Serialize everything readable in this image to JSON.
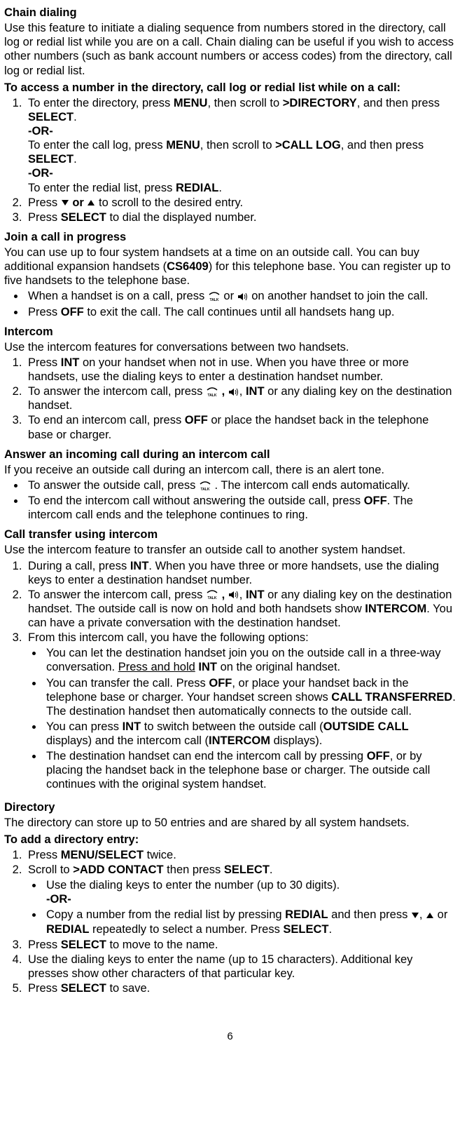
{
  "page_number": "6",
  "sections": {
    "chain_dialing": {
      "title": "Chain dialing",
      "intro": "Use this feature to initiate a dialing sequence from numbers stored in the directory, call log or redial list while you are on a call. Chain dialing can be useful if you wish to access other numbers (such as bank account numbers or access codes) from the directory, call log or redial list.",
      "access_heading": "To access a number in the directory, call log or redial list while on a call:",
      "step1_a": "To enter the directory, press ",
      "step1_b": "MENU",
      "step1_c": ", then scroll to ",
      "step1_d": ">DIRECTORY",
      "step1_e": ", and then press ",
      "step1_f": "SELECT",
      "step1_g": ".",
      "or": "-OR-",
      "step1h_a": "To enter the call log, press ",
      "step1h_b": "MENU",
      "step1h_c": ", then scroll to ",
      "step1h_d": ">CALL LOG",
      "step1h_e": ", and then press ",
      "step1h_f": "SELECT",
      "step1h_g": ".",
      "step1i_a": "To enter the redial list, press ",
      "step1i_b": "REDIAL",
      "step1i_c": ".",
      "step2_a": "Press ",
      "step2_b": " or ",
      "step2_c": " to scroll to the desired entry.",
      "step3_a": "Press ",
      "step3_b": "SELECT",
      "step3_c": " to dial the displayed number."
    },
    "join_call": {
      "title": "Join a call in progress",
      "intro_a": "You can use up to four system handsets at a time on an outside call. You can buy additional expansion handsets (",
      "intro_b": "CS6409",
      "intro_c": ") for this telephone base. You can register up to five handsets to the telephone base.",
      "b1_a": "When a handset is on a call, press ",
      "b1_b": " or ",
      "b1_c": " on another handset to join the call.",
      "b2_a": "Press ",
      "b2_b": "OFF",
      "b2_c": " to exit the call. The call continues until all handsets hang up."
    },
    "intercom": {
      "title": "Intercom",
      "intro": "Use the intercom features for conversations between two handsets.",
      "s1_a": "Press ",
      "s1_b": "INT",
      "s1_c": " on your handset when not in use. When you have three or more handsets, use the dialing keys to enter a destination handset number.",
      "s2_a": "To answer the intercom call, press ",
      "s2_b": " , ",
      "s2_c": ", ",
      "s2_d": "INT",
      "s2_e": " or any dialing key on the destination handset.",
      "s3_a": "To end an intercom call, press ",
      "s3_b": "OFF",
      "s3_c": " or place the handset back in the telephone base or charger."
    },
    "answer_incoming": {
      "title": "Answer an incoming call during an intercom call",
      "intro": "If you receive an outside call during an intercom call, there is an alert tone.",
      "b1_a": "To answer the outside call, press ",
      "b1_b": " . The intercom call ends automatically.",
      "b2_a": "To end the intercom call without answering the outside call, press ",
      "b2_b": "OFF",
      "b2_c": ". The intercom call ends and the telephone continues to ring."
    },
    "call_transfer": {
      "title": "Call transfer using intercom",
      "intro": "Use the intercom feature to transfer an outside call to another system handset.",
      "s1_a": "During a call, press ",
      "s1_b": "INT",
      "s1_c": ". When you have three or more handsets, use the dialing keys to enter a destination handset number.",
      "s2_a": "To answer the intercom call, press ",
      "s2_b": " , ",
      "s2_c": ", ",
      "s2_d": "INT",
      "s2_e": " or any dialing key on the destination handset. The outside call is now on hold and both handsets show ",
      "s2_f": "INTERCOM",
      "s2_g": ". You can have a private conversation with the destination handset.",
      "s3_intro": "From this intercom call, you have the following options:",
      "s3b1_a": "You can let the destination handset join you on the outside call in a three-way conversation. ",
      "s3b1_b": "Press and hold",
      "s3b1_c": " ",
      "s3b1_d": "INT",
      "s3b1_e": " on the original handset.",
      "s3b2_a": "You can transfer the call. Press ",
      "s3b2_b": "OFF",
      "s3b2_c": ", or place your handset back in the telephone base or charger. Your handset screen shows ",
      "s3b2_d": "CALL TRANSFERRED",
      "s3b2_e": ". The destination handset then automatically connects to the outside call.",
      "s3b3_a": "You can press ",
      "s3b3_b": "INT",
      "s3b3_c": " to switch between the outside call (",
      "s3b3_d": "OUTSIDE CALL",
      "s3b3_e": " displays) and the intercom call (",
      "s3b3_f": "INTERCOM",
      "s3b3_g": " displays).",
      "s3b4_a": "The destination handset can end the intercom call by pressing ",
      "s3b4_b": "OFF",
      "s3b4_c": ", or by placing the handset back in the telephone base or charger. The outside call continues with the original system handset."
    },
    "directory": {
      "title": "Directory",
      "intro": "The directory can store up to 50 entries and are shared by all system handsets.",
      "add_heading": "To add a directory entry:",
      "s1_a": "Press ",
      "s1_b": "MENU/SELECT",
      "s1_c": " twice.",
      "s2_a": "Scroll to ",
      "s2_b": ">ADD CONTACT",
      "s2_c": " then press ",
      "s2_d": "SELECT",
      "s2_e": ".",
      "s2b1": "Use the dialing keys to enter the number (up to 30 digits).",
      "or": "-OR-",
      "s2b2_a": "Copy a number from the redial list by pressing ",
      "s2b2_b": "REDIAL",
      "s2b2_c": " and then press ",
      "s2b2_d": ", ",
      "s2b2_e": " or ",
      "s2b2_f": "REDIAL",
      "s2b2_g": " repeatedly to select a number. Press ",
      "s2b2_h": "SELECT",
      "s2b2_i": ".",
      "s3_a": "Press ",
      "s3_b": "SELECT",
      "s3_c": " to move to the name.",
      "s4": "Use the dialing keys to enter the name (up to 15 characters). Additional key presses show other characters of that particular key.",
      "s5_a": "Press ",
      "s5_b": "SELECT",
      "s5_c": " to save."
    }
  },
  "icons": {
    "down": "down-arrow-icon",
    "up": "up-arrow-icon",
    "talk": "talk-icon",
    "speaker": "speaker-icon"
  }
}
